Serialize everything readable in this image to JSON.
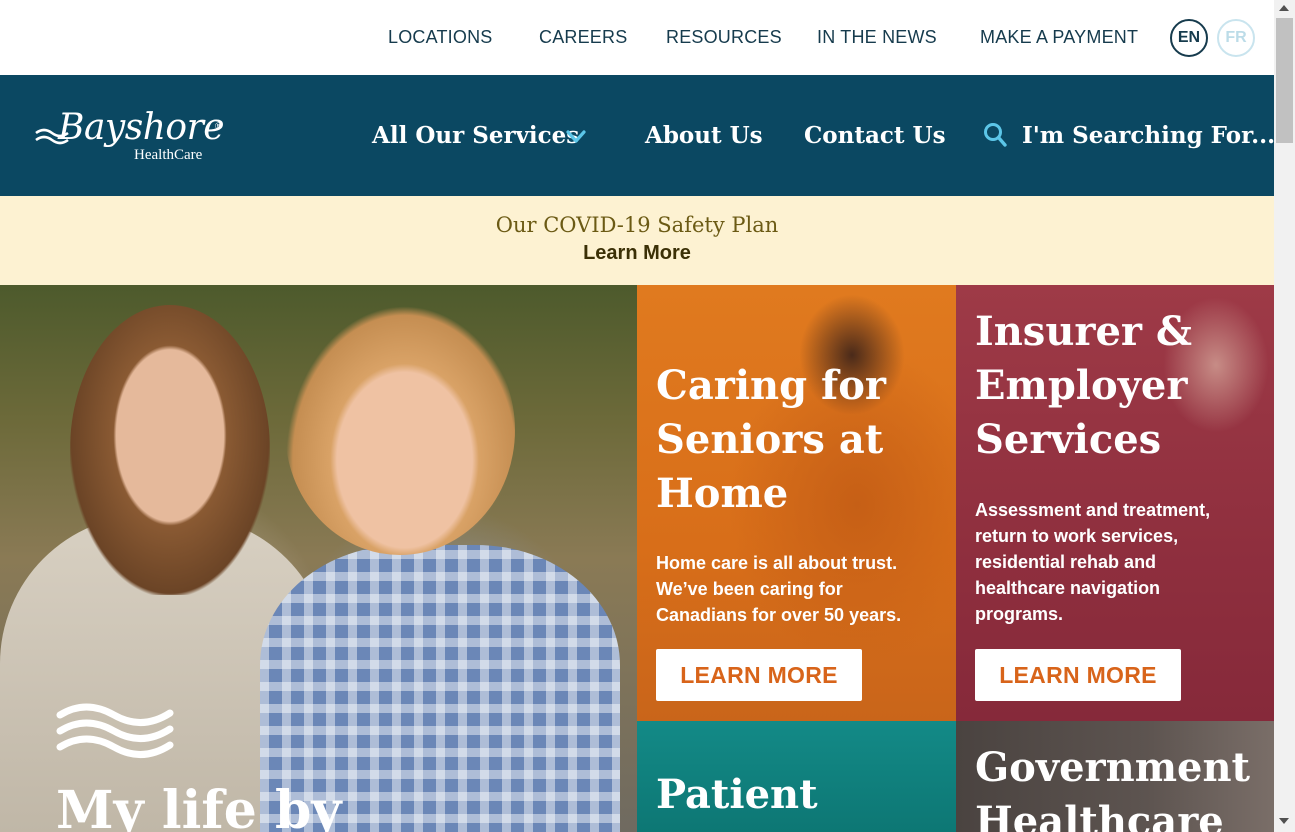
{
  "utility_nav": {
    "items": [
      "LOCATIONS",
      "CAREERS",
      "RESOURCES",
      "IN THE NEWS",
      "MAKE A PAYMENT"
    ],
    "lang_en": "EN",
    "lang_fr": "FR"
  },
  "logo": {
    "brand": "Bayshore",
    "registered": "®",
    "subtitle": "HealthCare"
  },
  "main_nav": {
    "services": "All Our Services",
    "about": "About Us",
    "contact": "Contact Us",
    "search": "I'm Searching For..."
  },
  "covid_banner": {
    "title": "Our COVID-19 Safety Plan",
    "link": "Learn More"
  },
  "hero": {
    "title": "My life by"
  },
  "tiles": {
    "seniors": {
      "title_lines": [
        "Caring for",
        "Seniors at",
        "Home"
      ],
      "body_lines": [
        "Home care is all about trust.",
        "We’ve been caring for",
        "Canadians for over 50 years."
      ],
      "button": "LEARN MORE"
    },
    "insurer": {
      "title_lines": [
        "Insurer &",
        "Employer",
        "Services"
      ],
      "body_lines": [
        "Assessment and treatment,",
        "return to work services,",
        "residential rehab and",
        "healthcare navigation",
        "programs."
      ],
      "button": "LEARN MORE"
    },
    "patient": {
      "title_lines": [
        "Patient"
      ]
    },
    "government": {
      "title_lines": [
        "Government",
        "Healthcare"
      ]
    }
  },
  "colors": {
    "navy": "#0b4862",
    "covid_bg": "#fdf2d2",
    "orange_tile": "#e07a1f",
    "maroon_tile": "#9e3a47",
    "teal_tile": "#138a87",
    "button_text": "#d8641a",
    "accent_light_blue": "#5cc6e8"
  },
  "icons": {
    "search": "search-icon",
    "chevron": "chevron-down-icon",
    "waves": "waves-icon"
  }
}
